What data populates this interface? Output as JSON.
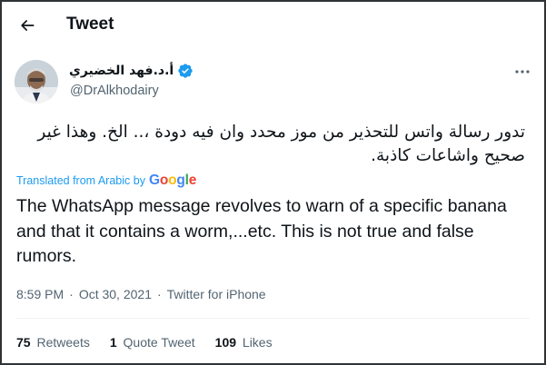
{
  "header": {
    "title": "Tweet",
    "back_icon": "arrow-left-icon"
  },
  "author": {
    "display_name": "أ.د.فهد الخضيري",
    "handle": "@DrAlkhodairy",
    "verified": true,
    "verified_color": "#1d9bf0"
  },
  "tweet": {
    "text_original": "تدور رسالة واتس للتحذير من موز  محدد وان فيه دودة ،.. الخ. وهذا غير صحيح واشاعات كاذبة.",
    "translated_label": "Translated from Arabic by",
    "translator": "Google",
    "text_translated": "The WhatsApp message revolves to warn of a specific banana and that it contains a worm,...etc. This is not true and false rumors."
  },
  "meta": {
    "time": "8:59 PM",
    "separator": "·",
    "date": "Oct 30, 2021",
    "source": "Twitter for iPhone"
  },
  "stats": {
    "retweets_count": "75",
    "retweets_label": "Retweets",
    "quotes_count": "1",
    "quotes_label": "Quote Tweet",
    "likes_count": "109",
    "likes_label": "Likes"
  },
  "colors": {
    "accent": "#1d9bf0",
    "text": "#0f1419",
    "secondary": "#536471"
  }
}
